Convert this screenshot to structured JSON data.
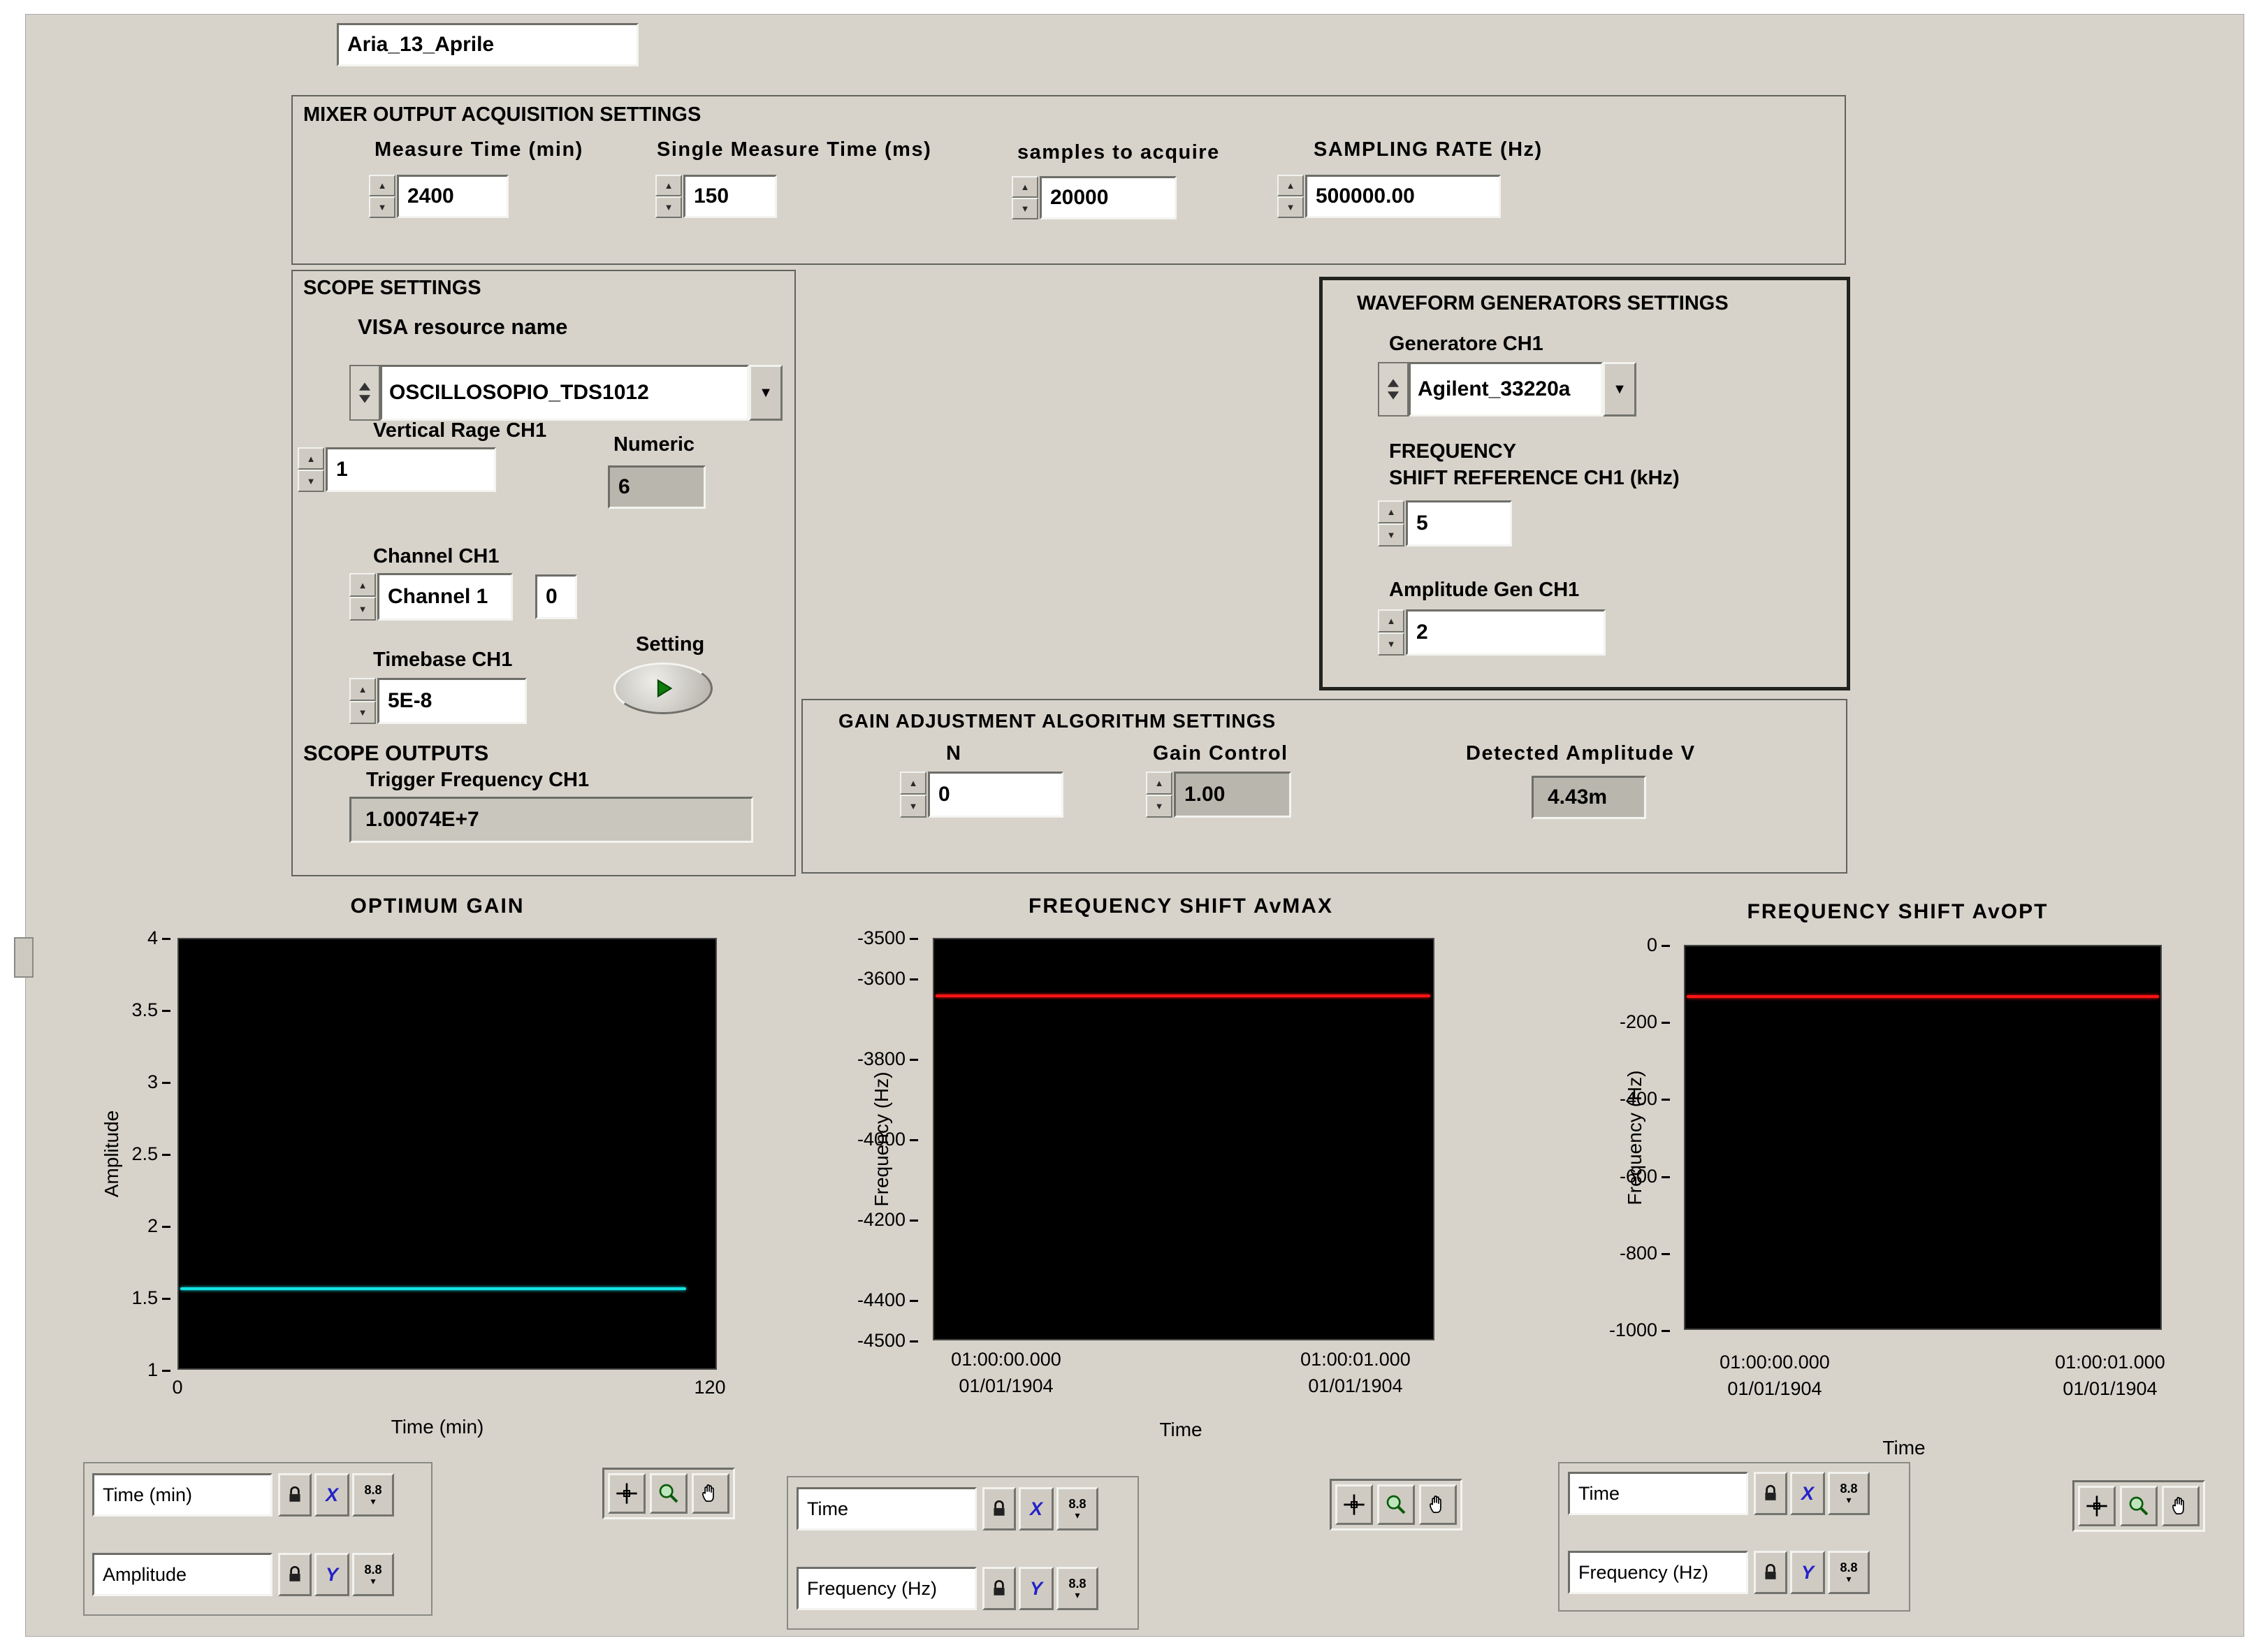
{
  "window": {
    "vi_name": "Aria_13_Aprile"
  },
  "icons": {
    "dropdown_arrow": "▼",
    "small_arrow": "▾",
    "spinner_up": "▲",
    "spinner_down": "▼"
  },
  "mixer": {
    "title": "MIXER OUTPUT ACQUISITION SETTINGS",
    "measure_time": {
      "label": "Measure Time (min)",
      "value": "2400"
    },
    "single_measure_time": {
      "label": "Single Measure Time (ms)",
      "value": "150"
    },
    "samples": {
      "label": "samples to acquire",
      "value": "20000"
    },
    "sampling_rate": {
      "label": "SAMPLING RATE (Hz)",
      "value": "500000.00"
    }
  },
  "scope": {
    "title": "SCOPE SETTINGS",
    "visa": {
      "label": "VISA resource name",
      "value": "OSCILLOSOPIO_TDS1012"
    },
    "vertical_range": {
      "label": "Vertical Rage CH1",
      "value": "1"
    },
    "numeric": {
      "label": "Numeric",
      "value": "6"
    },
    "channel": {
      "label": "Channel CH1",
      "value": "Channel 1",
      "index": "0"
    },
    "timebase": {
      "label": "Timebase CH1",
      "value": "5E-8"
    },
    "setting_label": "Setting",
    "outputs_title": "SCOPE OUTPUTS",
    "trigger": {
      "label": "Trigger Frequency CH1",
      "value": "1.00074E+7"
    }
  },
  "waveform": {
    "title": "WAVEFORM GENERATORS SETTINGS",
    "generator": {
      "label": "Generatore CH1",
      "value": "Agilent_33220a"
    },
    "freq": {
      "label1": "FREQUENCY",
      "label2": "SHIFT REFERENCE CH1 (kHz)",
      "value": "5"
    },
    "amplitude": {
      "label": "Amplitude Gen CH1",
      "value": "2"
    }
  },
  "gain": {
    "title": "GAIN ADJUSTMENT ALGORITHM SETTINGS",
    "n": {
      "label": "N",
      "value": "0"
    },
    "gain_control": {
      "label": "Gain Control",
      "value": "1.00"
    },
    "detected": {
      "label": "Detected Amplitude V",
      "value": "4.43m"
    }
  },
  "graph_palette": {
    "x_glyph": "X",
    "y_glyph": "Y",
    "format_glyph": "8.8"
  },
  "chart_data": [
    {
      "type": "line",
      "title": "OPTIMUM GAIN",
      "xlabel": "Time (min)",
      "ylabel": "Amplitude",
      "xlim": [
        0,
        120
      ],
      "ylim": [
        1,
        4
      ],
      "xticks": [
        0,
        120
      ],
      "yticks": [
        4,
        3.5,
        3,
        2.5,
        2,
        1.5,
        1
      ],
      "grid": false,
      "legend": "none",
      "plot_bg": "#000000",
      "series": [
        {
          "name": "Amplitude",
          "color": "#14e2e2",
          "shape": "flat-line",
          "value": 1.57,
          "x_start": 0,
          "x_end": 113
        }
      ]
    },
    {
      "type": "line",
      "title": "FREQUENCY SHIFT AvMAX",
      "xlabel": "Time",
      "ylabel": "Frequency (Hz)",
      "ylim": [
        -4500,
        -3500
      ],
      "yticks": [
        -3500,
        -3600,
        -3800,
        -4000,
        -4200,
        -4400,
        -4500
      ],
      "xtick_times": [
        "01:00:00.000",
        "01:00:01.000"
      ],
      "xtick_dates": [
        "01/01/1904",
        "01/01/1904"
      ],
      "grid": false,
      "legend": "none",
      "plot_bg": "#000000",
      "series": [
        {
          "name": "Frequency",
          "color": "#ff1414",
          "shape": "flat-line",
          "value": -3640
        }
      ]
    },
    {
      "type": "line",
      "title": "FREQUENCY SHIFT AvOPT",
      "xlabel": "Time",
      "ylabel": "Frequency (Hz)",
      "ylim": [
        -1000,
        0
      ],
      "yticks": [
        0,
        -200,
        -400,
        -600,
        -800,
        -1000
      ],
      "xtick_times": [
        "01:00:00.000",
        "01:00:01.000"
      ],
      "xtick_dates": [
        "01/01/1904",
        "01/01/1904"
      ],
      "grid": false,
      "legend": "none",
      "plot_bg": "#000000",
      "series": [
        {
          "name": "Frequency",
          "color": "#ff1414",
          "shape": "flat-line",
          "value": -130
        }
      ]
    }
  ]
}
